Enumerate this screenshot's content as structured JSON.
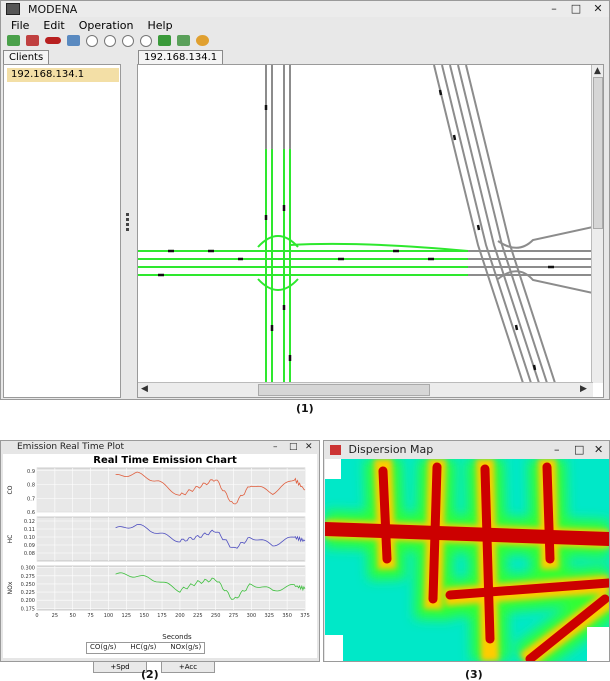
{
  "app": {
    "title": "MODENA",
    "window_controls": [
      "–",
      "□",
      "✕"
    ],
    "menu": [
      "File",
      "Edit",
      "Operation",
      "Help"
    ],
    "toolbar_icons": [
      "run-icon",
      "stop-icon",
      "car-icon",
      "export-icon",
      "play-icon",
      "pause-icon",
      "fast-forward-icon",
      "rewind-icon",
      "grid-icon",
      "grid-alt-icon",
      "palette-icon"
    ],
    "left_tab": "Clients",
    "client_item": "192.168.134.1",
    "map_tab": "192.168.134.1",
    "colors": {
      "road": "#8c8c8c",
      "active_road": "#2ee82e",
      "vehicle": "#111111",
      "selected": "#f3dfa6"
    }
  },
  "captions": [
    "(1)",
    "(2)",
    "(3)"
  ],
  "emission_window": {
    "title": "Emission Real Time Plot",
    "chart_title": "Real Time Emission Chart",
    "legend": [
      "CO(g/s)",
      "HC(g/s)",
      "NOx(g/s)"
    ],
    "buttons": [
      "+Spd",
      "+Acc"
    ]
  },
  "chart_data": {
    "type": "line",
    "title": "Real Time Emission Chart",
    "xlabel": "Seconds",
    "xlim": [
      0,
      375
    ],
    "x_ticks": [
      0,
      25,
      50,
      75,
      100,
      125,
      150,
      175,
      200,
      225,
      250,
      275,
      300,
      325,
      350,
      375
    ],
    "panels": [
      {
        "ylabel": "CO",
        "color": "#e06040",
        "ylim": [
          0.6,
          0.92
        ],
        "y_ticks": [
          "0.9",
          "0.8",
          "0.7",
          "0.6"
        ],
        "x": [
          110,
          140,
          170,
          200,
          225,
          250,
          275,
          300,
          330,
          360,
          375
        ],
        "values": [
          0.86,
          0.88,
          0.82,
          0.72,
          0.78,
          0.84,
          0.65,
          0.8,
          0.74,
          0.84,
          0.76
        ]
      },
      {
        "ylabel": "HC",
        "color": "#5050c0",
        "ylim": [
          0.07,
          0.125
        ],
        "y_ticks": [
          "0.12",
          "0.11",
          "0.10",
          "0.09",
          "0.08"
        ],
        "x": [
          110,
          140,
          170,
          200,
          225,
          250,
          275,
          300,
          330,
          360,
          375
        ],
        "values": [
          0.11,
          0.115,
          0.105,
          0.095,
          0.1,
          0.108,
          0.085,
          0.1,
          0.09,
          0.1,
          0.095
        ]
      },
      {
        "ylabel": "NOx",
        "color": "#40c040",
        "ylim": [
          0.17,
          0.305
        ],
        "y_ticks": [
          "0.300",
          "0.275",
          "0.250",
          "0.225",
          "0.200",
          "0.175"
        ],
        "x": [
          110,
          140,
          170,
          200,
          225,
          250,
          275,
          300,
          330,
          360,
          375
        ],
        "values": [
          0.28,
          0.275,
          0.26,
          0.23,
          0.255,
          0.265,
          0.2,
          0.25,
          0.23,
          0.245,
          0.235
        ]
      }
    ]
  },
  "dispersion_window": {
    "title": "Dispersion Map",
    "colors": {
      "low": "#00ffff",
      "mid": "#00ff00",
      "high": "#ff0000",
      "peak": "#cc0000"
    }
  }
}
